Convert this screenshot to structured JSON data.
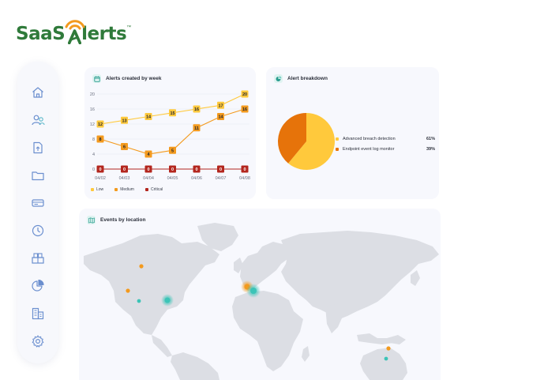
{
  "brand": {
    "name_left": "SaaS",
    "name_right": "lerts",
    "trademark": "™",
    "colors": {
      "green": "#2f7a3a",
      "orange": "#f39a1e",
      "accent": "#3cc4b7"
    }
  },
  "sidebar": {
    "items": [
      {
        "id": "home",
        "icon": "home-icon"
      },
      {
        "id": "users",
        "icon": "users-icon"
      },
      {
        "id": "reports",
        "icon": "document-icon"
      },
      {
        "id": "files",
        "icon": "folder-icon"
      },
      {
        "id": "devices",
        "icon": "device-icon"
      },
      {
        "id": "history",
        "icon": "clock-icon"
      },
      {
        "id": "integrations",
        "icon": "boxes-icon"
      },
      {
        "id": "analytics",
        "icon": "pie-chart-icon"
      },
      {
        "id": "organizations",
        "icon": "buildings-icon"
      },
      {
        "id": "settings",
        "icon": "gear-icon"
      }
    ]
  },
  "alerts_card": {
    "title": "Alerts created by week",
    "icon": "calendar-icon"
  },
  "breakdown_card": {
    "title": "Alert breakdown",
    "icon": "pie-chart-icon"
  },
  "map_card": {
    "title": "Events by location",
    "icon": "map-icon",
    "event_colors": {
      "orange": "#f39a1e",
      "teal": "#3cc4b7"
    }
  },
  "chart_data": [
    {
      "type": "line",
      "title": "Alerts created by week",
      "categories": [
        "04/02",
        "04/03",
        "04/04",
        "04/05",
        "04/06",
        "04/07",
        "04/08"
      ],
      "series": [
        {
          "name": "Low",
          "color": "#ffc93c",
          "values": [
            12,
            13,
            14,
            15,
            16,
            17,
            20
          ]
        },
        {
          "name": "Medium",
          "color": "#f39a1e",
          "values": [
            8,
            6,
            4,
            5,
            11,
            14,
            16
          ]
        },
        {
          "name": "Critical",
          "color": "#b3261e",
          "values": [
            0,
            0,
            0,
            0,
            0,
            0,
            0
          ]
        }
      ],
      "yticks": [
        0,
        4,
        8,
        12,
        16,
        20
      ],
      "ylim": [
        0,
        20
      ],
      "grid": true,
      "legend": "bottom-left"
    },
    {
      "type": "pie",
      "title": "Alert breakdown",
      "slices": [
        {
          "label": "Advanced breach detection",
          "value": 61,
          "display": "61%",
          "color": "#ffc93c"
        },
        {
          "label": "Endpoint event log monitor",
          "value": 39,
          "display": "39%",
          "color": "#e6730a"
        }
      ],
      "legend": "right"
    }
  ]
}
